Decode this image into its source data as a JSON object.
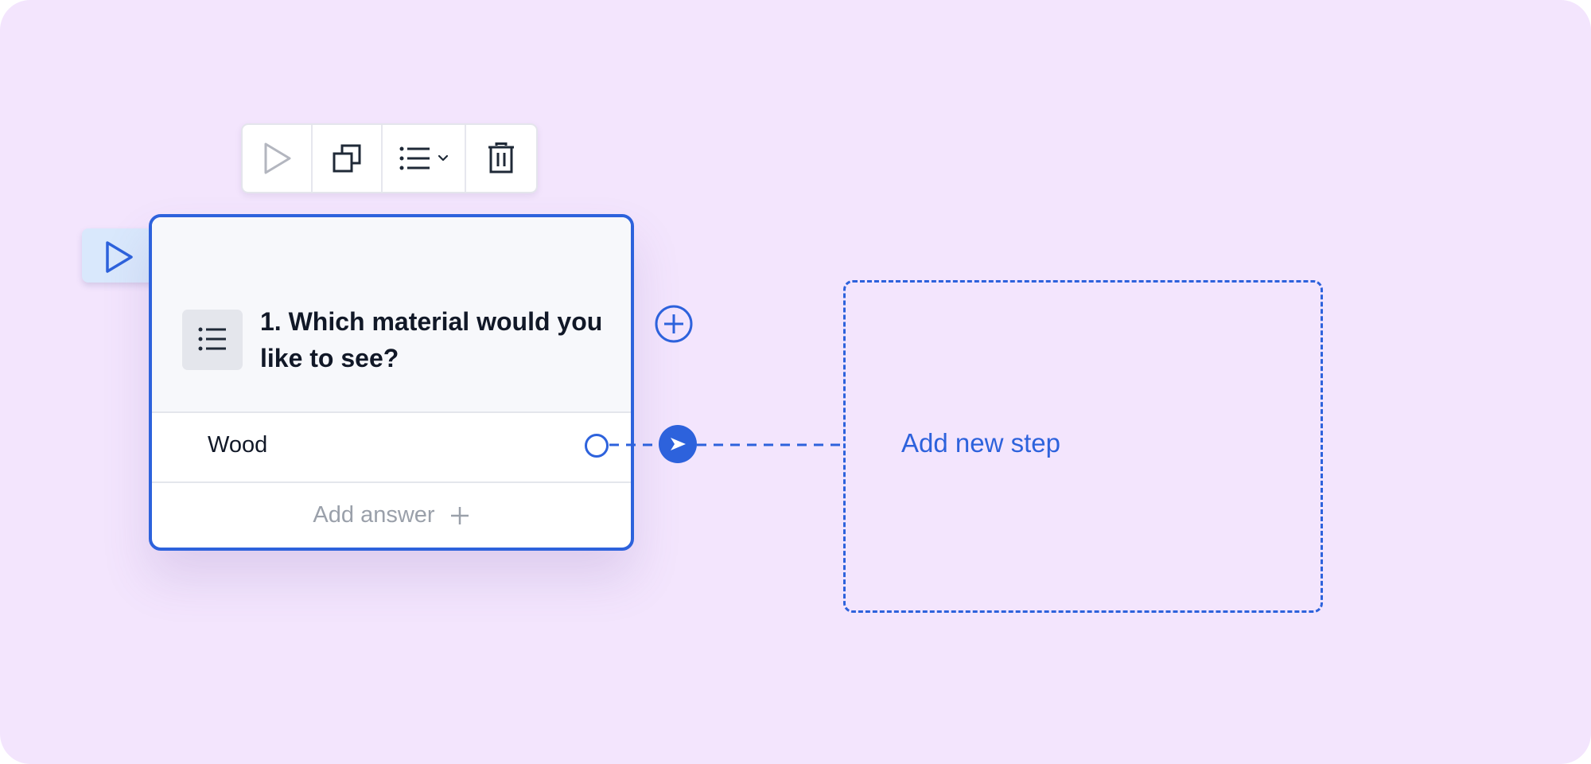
{
  "colors": {
    "canvas_bg": "#f3e5fd",
    "accent": "#2d62dc",
    "card_header_bg": "#f7f8fb",
    "muted_text": "#9aa0aa",
    "start_badge_bg": "#d9e8fc"
  },
  "toolbar": {
    "buttons": [
      {
        "icon": "play-icon",
        "state": "disabled"
      },
      {
        "icon": "duplicate-icon"
      },
      {
        "icon": "list-type-icon",
        "has_dropdown": true
      },
      {
        "icon": "trash-icon"
      }
    ]
  },
  "start_badge": {
    "icon": "play-icon"
  },
  "node": {
    "type_icon": "list-icon",
    "title": "1. Which material would you like to see?",
    "answers": [
      {
        "label": "Wood"
      }
    ],
    "add_answer_label": "Add answer"
  },
  "connector": {
    "add_icon": "plus-circle-icon",
    "arrow_icon": "arrow-right-icon"
  },
  "placeholder": {
    "label": "Add new step"
  }
}
